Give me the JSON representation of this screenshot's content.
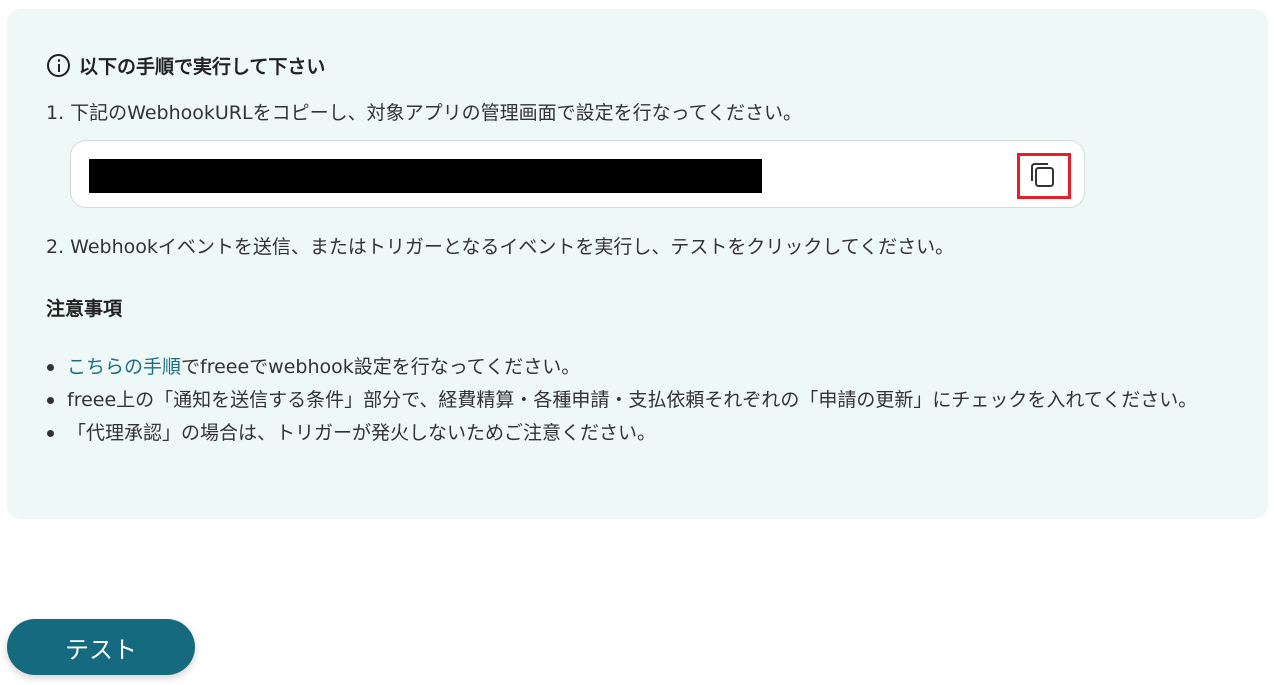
{
  "instructions": {
    "heading": "以下の手順で実行して下さい",
    "step1": "1. 下記のWebhookURLをコピーし、対象アプリの管理画面で設定を行なってください。",
    "step2": "2. Webhookイベントを送信、またはトリガーとなるイベントを実行し、テストをクリックしてください。"
  },
  "notes": {
    "title": "注意事項",
    "items": [
      {
        "link": "こちらの手順",
        "text": "でfreeeでwebhook設定を行なってください。"
      },
      {
        "text": "freee上の「通知を送信する条件」部分で、経費精算・各種申請・支払依頼それぞれの「申請の更新」にチェックを入れてください。"
      },
      {
        "text": "「代理承認」の場合は、トリガーが発火しないためご注意ください。"
      }
    ]
  },
  "test_button": {
    "label": "テスト"
  },
  "icons": {
    "info": "info-circle-icon",
    "copy": "copy-icon"
  },
  "colors": {
    "panel_bg": "#eef8f6",
    "link": "#1b6e82",
    "button_bg": "#156a80",
    "highlight": "#e0202a"
  }
}
